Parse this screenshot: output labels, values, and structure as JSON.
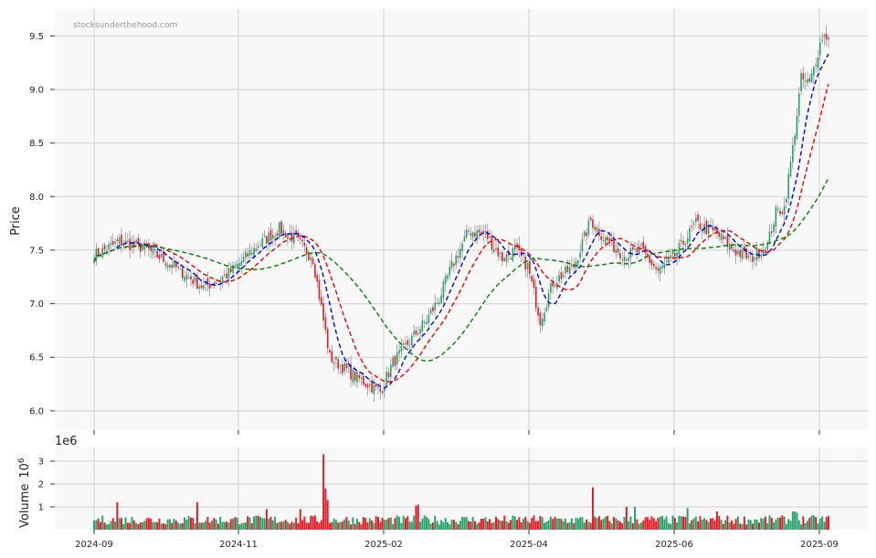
{
  "watermark": "stocksunderthehood.com",
  "chart_data": [
    {
      "type": "candlestick",
      "title": "",
      "ylabel": "Price",
      "ylim": [
        5.82,
        9.75
      ],
      "y_ticks": [
        "6.0",
        "6.5",
        "7.0",
        "7.5",
        "8.0",
        "8.5",
        "9.0",
        "9.5"
      ],
      "x_ticks": [
        "2024-09",
        "2024-11",
        "2025-02",
        "2025-04",
        "2025-06",
        "2025-09"
      ],
      "grid": true,
      "legend": "none",
      "colors": {
        "up": "#26a269",
        "down": "#e01b24",
        "ma_fast": "#0000ee",
        "ma_mid": "#ee0000",
        "ma_slow": "#008000"
      },
      "price_path": [
        [
          0,
          7.45
        ],
        [
          12,
          7.58
        ],
        [
          24,
          7.52
        ],
        [
          38,
          7.35
        ],
        [
          52,
          7.15
        ],
        [
          64,
          7.28
        ],
        [
          78,
          7.55
        ],
        [
          88,
          7.7
        ],
        [
          96,
          7.6
        ],
        [
          104,
          7.42
        ],
        [
          112,
          6.5
        ],
        [
          124,
          6.32
        ],
        [
          136,
          6.18
        ],
        [
          142,
          6.45
        ],
        [
          150,
          6.65
        ],
        [
          158,
          6.85
        ],
        [
          164,
          7.05
        ],
        [
          170,
          7.35
        ],
        [
          178,
          7.68
        ],
        [
          186,
          7.65
        ],
        [
          194,
          7.42
        ],
        [
          200,
          7.5
        ],
        [
          206,
          7.35
        ],
        [
          212,
          6.85
        ],
        [
          218,
          7.2
        ],
        [
          228,
          7.35
        ],
        [
          236,
          7.78
        ],
        [
          242,
          7.62
        ],
        [
          252,
          7.45
        ],
        [
          260,
          7.5
        ],
        [
          268,
          7.3
        ],
        [
          276,
          7.45
        ],
        [
          286,
          7.75
        ],
        [
          296,
          7.65
        ],
        [
          304,
          7.5
        ],
        [
          312,
          7.42
        ],
        [
          320,
          7.55
        ],
        [
          324,
          7.85
        ],
        [
          328,
          7.9
        ],
        [
          332,
          8.45
        ],
        [
          336,
          9.1
        ],
        [
          340,
          9.05
        ],
        [
          346,
          9.5
        ]
      ],
      "series": [
        {
          "kind": "moving-average",
          "color": "#0000ee",
          "style": "dashed"
        },
        {
          "kind": "moving-average",
          "color": "#ee0000",
          "style": "dashed"
        },
        {
          "kind": "moving-average",
          "color": "#008000",
          "style": "dashed"
        }
      ]
    },
    {
      "type": "bar",
      "title": "",
      "ylabel": "Volume",
      "ylabel_exponent": "10",
      "ylabel_exponent_power": "6",
      "offset_text": "1e6",
      "ylim": [
        0,
        3.6
      ],
      "y_ticks": [
        "1",
        "2",
        "3"
      ],
      "volume_peaks": [
        {
          "day": 11,
          "value": 1.2
        },
        {
          "day": 49,
          "value": 1.2
        },
        {
          "day": 82,
          "value": 0.9
        },
        {
          "day": 98,
          "value": 0.9
        },
        {
          "day": 109,
          "value": 3.3
        },
        {
          "day": 110,
          "value": 1.8
        },
        {
          "day": 111,
          "value": 1.3
        },
        {
          "day": 153,
          "value": 1.05
        },
        {
          "day": 154,
          "value": 1.1
        },
        {
          "day": 237,
          "value": 1.85
        },
        {
          "day": 253,
          "value": 1.0
        },
        {
          "day": 257,
          "value": 1.0
        },
        {
          "day": 282,
          "value": 0.95
        },
        {
          "day": 296,
          "value": 0.8
        },
        {
          "day": 332,
          "value": 0.8
        },
        {
          "day": 333,
          "value": 0.8
        },
        {
          "day": 334,
          "value": 0.75
        }
      ],
      "volume_base": 0.45
    }
  ]
}
